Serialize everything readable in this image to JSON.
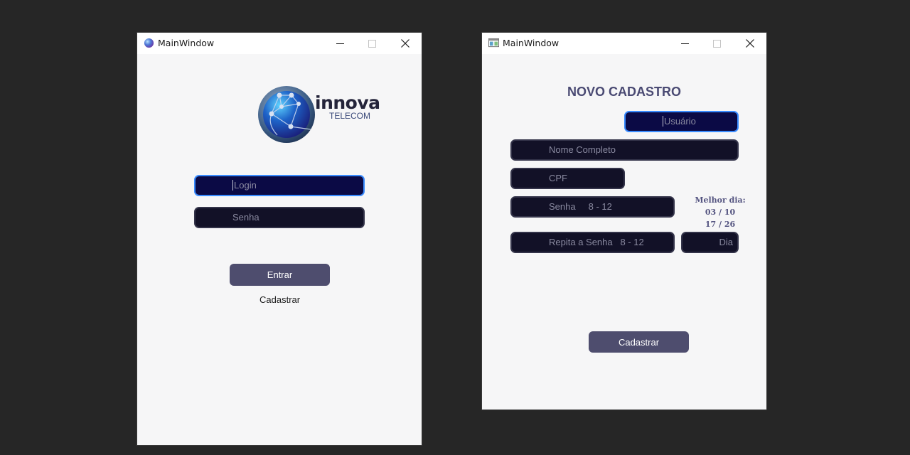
{
  "login_window": {
    "title": "MainWindow",
    "brand": {
      "name": "innova",
      "sub": "TELECOM"
    },
    "login_placeholder": "Login",
    "password_placeholder": "Senha",
    "enter_label": "Entrar",
    "register_link": "Cadastrar"
  },
  "register_window": {
    "title": "MainWindow",
    "heading": "NOVO CADASTRO",
    "user_placeholder": "Usuário",
    "fullname_placeholder": "Nome Completo",
    "cpf_placeholder": "CPF",
    "password_placeholder": "Senha     8 - 12",
    "repeat_password_placeholder": "Repita a Senha   8 - 12",
    "day_placeholder": "Dia",
    "best_day_title": "Melhor dia:",
    "best_day_line1": "03 / 10",
    "best_day_line2": "17 / 26",
    "submit_label": "Cadastrar"
  },
  "icons": {
    "login_app_icon": "globe-icon",
    "register_app_icon": "window-icon",
    "minimize": "minimize-icon",
    "maximize": "maximize-icon",
    "close": "close-icon",
    "logo": "globe-network-logo"
  },
  "colors": {
    "background": "#262626",
    "window": "#f6f6f7",
    "field_bg": "#121127",
    "field_focus_bg": "#0b0a45",
    "focus_border": "#3a8cff",
    "button": "#4e4d6e",
    "heading": "#4a4a73"
  }
}
